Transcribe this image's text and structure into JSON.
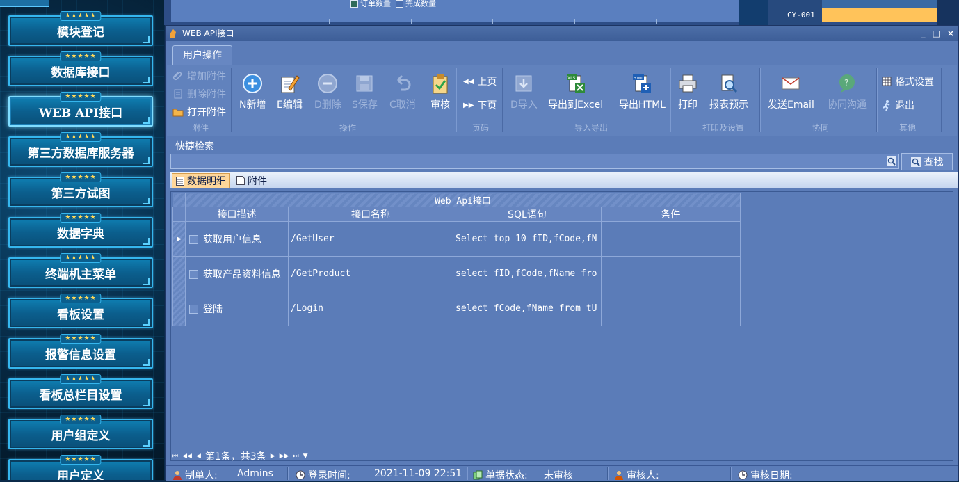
{
  "sidebar": {
    "items": [
      {
        "label": "模块登记"
      },
      {
        "label": "数据库接口"
      },
      {
        "label": "WEB API接口"
      },
      {
        "label": "第三方数据库服务器"
      },
      {
        "label": "第三方试图"
      },
      {
        "label": "数据字典"
      },
      {
        "label": "终端机主菜单"
      },
      {
        "label": "看板设置"
      },
      {
        "label": "报警信息设置"
      },
      {
        "label": "看板总栏目设置"
      },
      {
        "label": "用户组定义"
      },
      {
        "label": "用户定义"
      }
    ],
    "stars": "★★★★★",
    "active_index": 2
  },
  "background": {
    "legend_order": "订单数量",
    "legend_done": "完成数量",
    "code": "CY-001",
    "bar_color": "#ffc35a"
  },
  "window": {
    "title": "WEB API接口",
    "controls": {
      "minimize": "_",
      "maximize": "□",
      "close": "×"
    }
  },
  "ribbon": {
    "tab": "用户操作",
    "groups": {
      "attachment": {
        "label": "附件",
        "add": "增加附件",
        "delete": "删除附件",
        "open": "打开附件"
      },
      "operation": {
        "label": "操作",
        "new": "N新增",
        "edit": "E编辑",
        "del": "D删除",
        "save": "S保存",
        "cancel": "C取消",
        "audit": "审核"
      },
      "page": {
        "label": "页码",
        "prev": "上页",
        "next": "下页"
      },
      "importexport": {
        "label": "导入导出",
        "import": "D导入",
        "excel": "导出到Excel",
        "html": "导出HTML"
      },
      "print": {
        "label": "打印及设置",
        "print": "打印",
        "preview": "报表预示"
      },
      "collab": {
        "label": "协同",
        "email": "发送Email",
        "chat": "协同沟通"
      },
      "other": {
        "label": "其他",
        "format": "格式设置",
        "exit": "退出"
      }
    }
  },
  "quick_search": {
    "label": "快捷检索",
    "value": "",
    "button": "查找"
  },
  "tabs": [
    {
      "label": "数据明细"
    },
    {
      "label": "附件"
    }
  ],
  "grid": {
    "band_title": "Web Api接口",
    "columns": [
      "接口描述",
      "接口名称",
      "SQL语句",
      "条件"
    ],
    "rows": [
      {
        "desc": "获取用户信息",
        "name": "/GetUser",
        "sql": "Select top 10 fID,fCode,fN",
        "cond": ""
      },
      {
        "desc": "获取产品资料信息",
        "name": "/GetProduct",
        "sql": "select fID,fCode,fName fro",
        "cond": ""
      },
      {
        "desc": "登陆",
        "name": "/Login",
        "sql": "select fCode,fName from tU",
        "cond": ""
      }
    ]
  },
  "navigator": {
    "text": "第1条，共3条"
  },
  "status": {
    "creator_label": "制单人:",
    "creator": "Admins",
    "login_time_label": "登录时间:",
    "login_time": "2021-11-09 22:51",
    "doc_status_label": "单据状态:",
    "doc_status": "未审核",
    "auditor_label": "审核人:",
    "auditor": "",
    "audit_date_label": "审核日期:",
    "audit_date": ""
  }
}
